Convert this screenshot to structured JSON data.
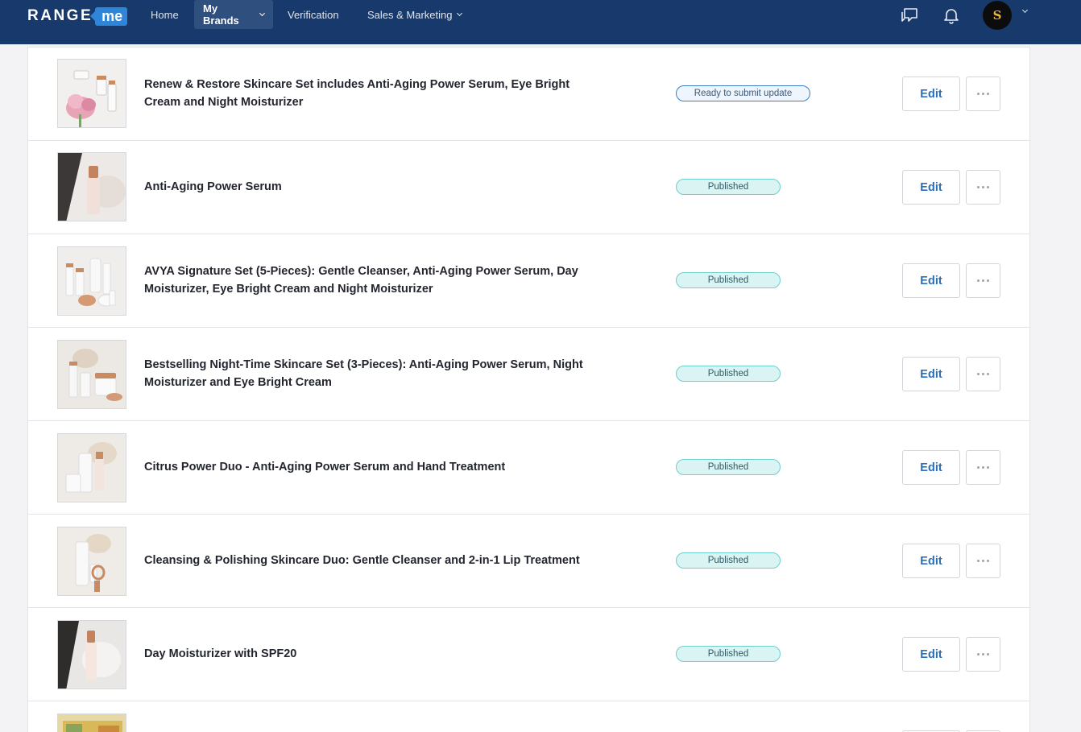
{
  "nav": {
    "logo_range": "RANGE",
    "logo_me": "me",
    "links": [
      {
        "label": "Home"
      },
      {
        "label": "My Brands"
      },
      {
        "label": "Verification"
      },
      {
        "label": "Sales & Marketing"
      }
    ],
    "avatar_initial": "S",
    "icons": [
      "chat-icon",
      "bell-icon",
      "chevron-down-icon"
    ]
  },
  "products": [
    {
      "name": "Renew & Restore Skincare Set includes Anti-Aging Power Serum, Eye Bright Cream and Night Moisturizer",
      "status": "Ready to submit update",
      "edit_label": "Edit"
    },
    {
      "name": "Anti-Aging Power Serum",
      "status": "Published",
      "edit_label": "Edit"
    },
    {
      "name": "AVYA Signature Set (5-Pieces): Gentle Cleanser, Anti-Aging Power Serum, Day Moisturizer, Eye Bright Cream and Night Moisturizer",
      "status": "Published",
      "edit_label": "Edit"
    },
    {
      "name": "Bestselling Night-Time Skincare Set (3-Pieces): Anti-Aging Power Serum, Night Moisturizer and Eye Bright Cream",
      "status": "Published",
      "edit_label": "Edit"
    },
    {
      "name": "Citrus Power Duo - Anti-Aging Power Serum and Hand Treatment",
      "status": "Published",
      "edit_label": "Edit"
    },
    {
      "name": "Cleansing & Polishing Skincare Duo: Gentle Cleanser and 2-in-1 Lip Treatment",
      "status": "Published",
      "edit_label": "Edit"
    },
    {
      "name": "Day Moisturizer with SPF20",
      "status": "Published",
      "edit_label": "Edit"
    }
  ],
  "colors": {
    "nav_bg": "#17396b",
    "accent": "#2f86d8",
    "published_badge": "#d9f4f2",
    "edit_text": "#2b6fb8"
  }
}
